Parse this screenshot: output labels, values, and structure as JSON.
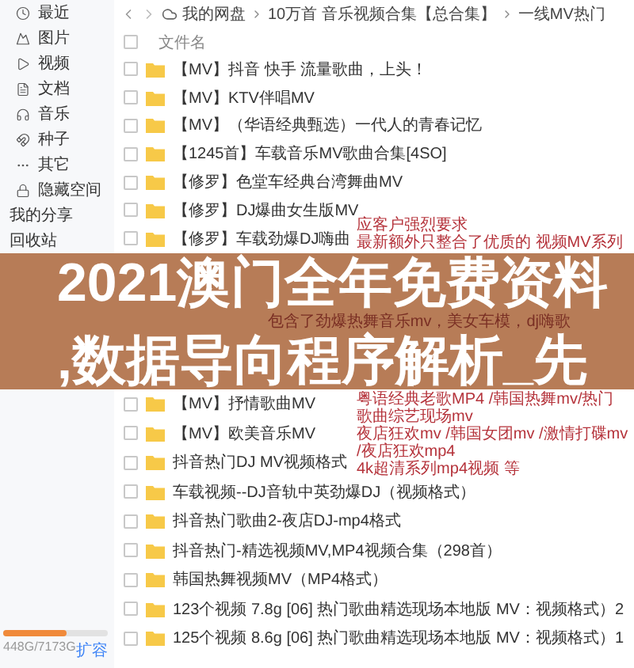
{
  "toolbar": {
    "breadcrumb": [
      "我的网盘",
      "10万首 音乐视频合集【总合集】",
      "一线MV热门"
    ]
  },
  "sidebar": {
    "items": [
      {
        "label": "最近",
        "kind": "category"
      },
      {
        "label": "图片",
        "kind": "category"
      },
      {
        "label": "视频",
        "kind": "category"
      },
      {
        "label": "文档",
        "kind": "category"
      },
      {
        "label": "音乐",
        "kind": "category"
      },
      {
        "label": "种子",
        "kind": "category"
      },
      {
        "label": "其它",
        "kind": "category"
      },
      {
        "label": "隐藏空间",
        "kind": "category"
      },
      {
        "label": "我的分享",
        "kind": "section"
      },
      {
        "label": "回收站",
        "kind": "section"
      }
    ],
    "storage": {
      "usage": "448G/7173G",
      "level": 0.6,
      "upgrade": "扩容"
    }
  },
  "file_list": {
    "header": "文件名",
    "header_checked": false,
    "rows_top": [
      {
        "name": "【MV】抖音 快手 流量歌曲，上头！",
        "checked": false
      },
      {
        "name": "【MV】KTV伴唱MV",
        "checked": false
      },
      {
        "name": "【MV】（华语经典甄选）一代人的青春记忆",
        "checked": false
      },
      {
        "name": "【1245首】车载音乐MV歌曲合集[4SO]",
        "checked": false
      },
      {
        "name": "【修罗】色堂车经典台湾舞曲MV",
        "checked": false
      },
      {
        "name": "【修罗】DJ爆曲女生版MV",
        "checked": false
      },
      {
        "name": "【修罗】车载劲爆DJ嗨曲",
        "checked": false
      }
    ],
    "rows_bottom": [
      {
        "name": "【MV】抒情歌曲MV",
        "checked": false
      },
      {
        "name": "【MV】欧美音乐MV",
        "checked": false
      },
      {
        "name": "抖音热门DJ MV视频格式",
        "checked": false
      },
      {
        "name": "车载视频--DJ音轨中英劲爆DJ（视频格式）",
        "checked": false
      },
      {
        "name": "抖音热门歌曲2-夜店DJ-mp4格式",
        "checked": false
      },
      {
        "name": "抖音热门-精选视频MV,MP4视频合集（298首）",
        "checked": false
      },
      {
        "name": "韩国热舞视频MV（MP4格式）",
        "checked": false
      },
      {
        "name": "123个视频 7.8g [06] 热门歌曲精选现场本地版 MV：视频格式）2",
        "checked": false
      },
      {
        "name": "125个视频 8.6g [06] 热门歌曲精选现场本地版 MV：视频格式）1",
        "checked": false
      }
    ]
  },
  "promo_note_top": [
    "应客户强烈要求",
    "最新额外只整合了优质的 视频MV系列"
  ],
  "banner": {
    "line_1": "2021澳门全年免费资料",
    "note": "包含了劲爆热舞音乐mv，美女车模，dj嗨歌",
    "line_2": ",数据导向程序解析_先"
  },
  "promo_note_bottom": [
    "粤语经典老歌MP4 /韩国热舞mv/热门歌曲综艺现场mv",
    "夜店狂欢mv /韩国女团mv /激情打碟mv /夜店狂欢mp4",
    "4k超清系列mp4视频 等"
  ]
}
